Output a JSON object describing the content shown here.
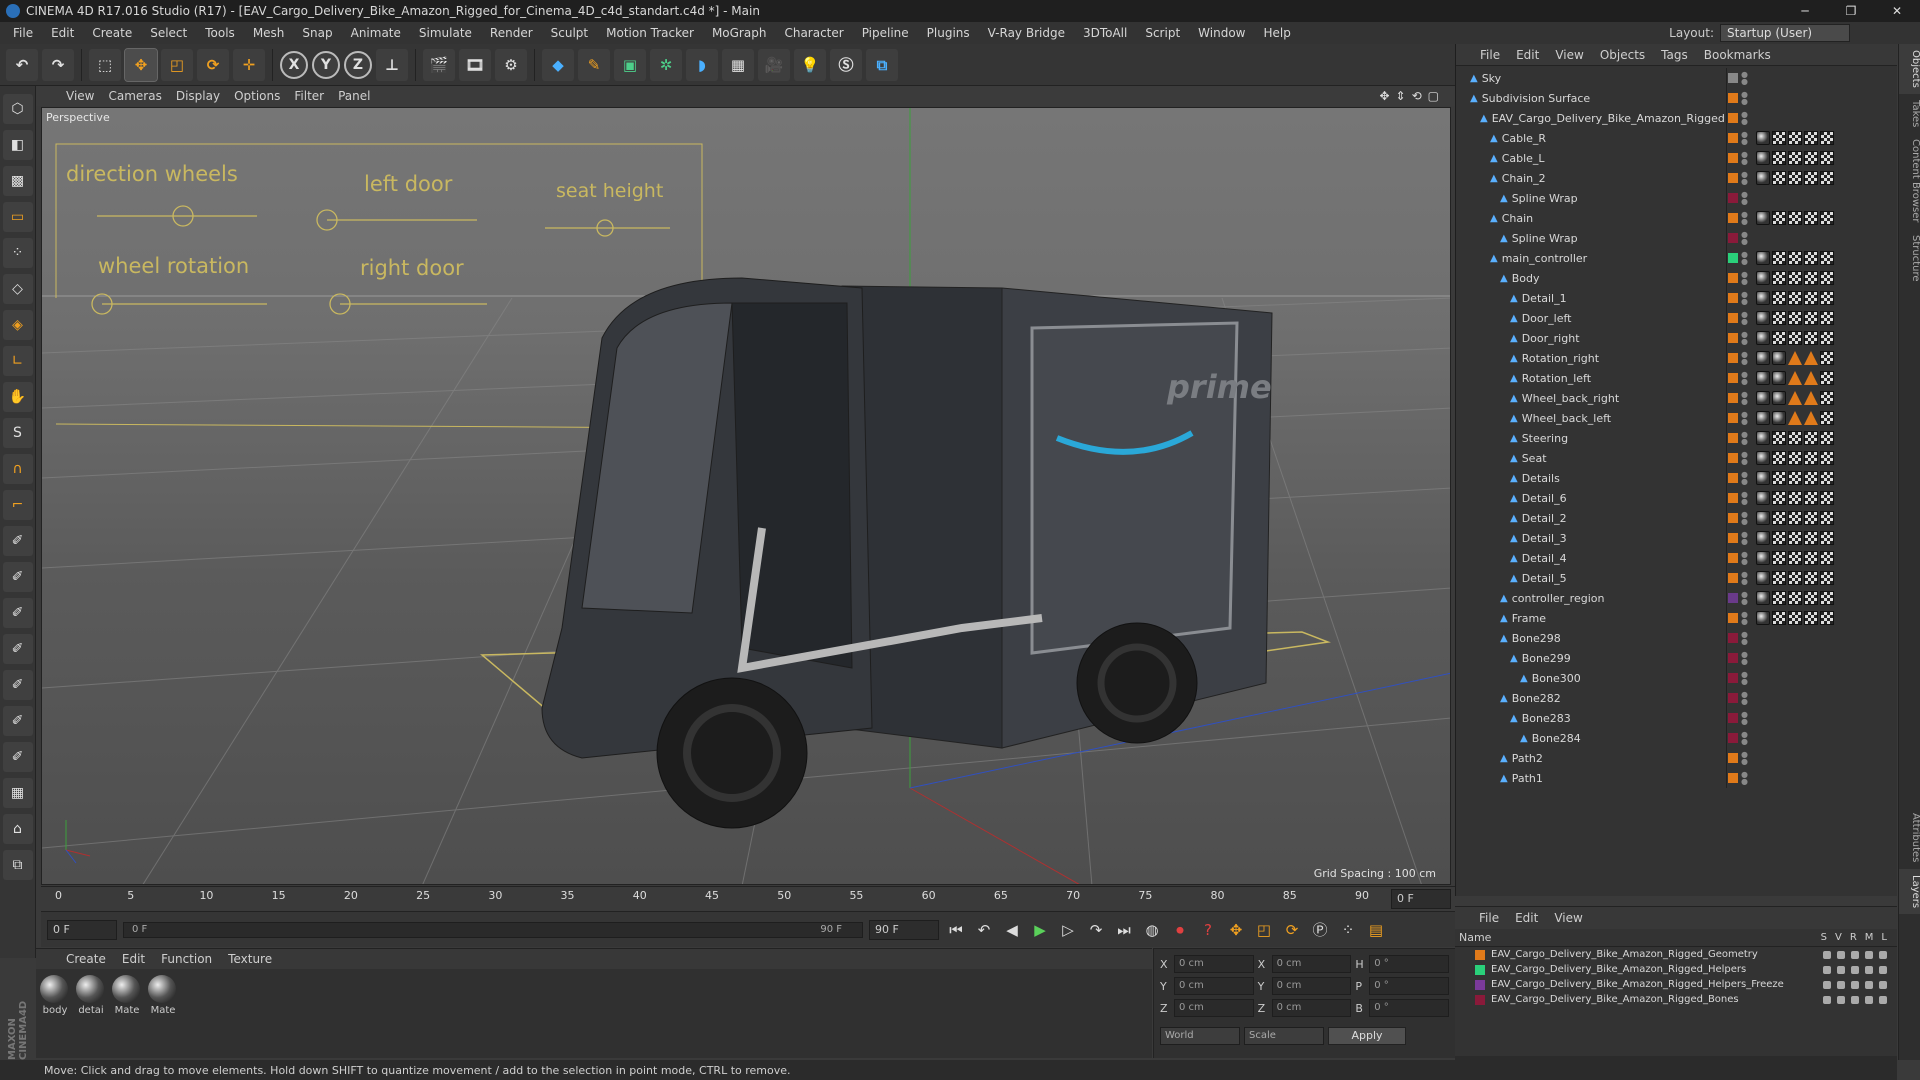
{
  "title": "CINEMA 4D R17.016 Studio (R17) - [EAV_Cargo_Delivery_Bike_Amazon_Rigged_for_Cinema_4D_c4d_standart.c4d *] - Main",
  "menu": [
    "File",
    "Edit",
    "Create",
    "Select",
    "Tools",
    "Mesh",
    "Snap",
    "Animate",
    "Simulate",
    "Render",
    "Sculpt",
    "Motion Tracker",
    "MoGraph",
    "Character",
    "Pipeline",
    "Plugins",
    "V-Ray Bridge",
    "3DToAll",
    "Script",
    "Window",
    "Help"
  ],
  "layout_label": "Layout:",
  "layout_value": "Startup (User)",
  "toolbar": {
    "x": "X",
    "y": "Y",
    "z": "Z"
  },
  "viewport": {
    "menu": [
      "View",
      "Cameras",
      "Display",
      "Options",
      "Filter",
      "Panel"
    ],
    "label": "Perspective",
    "grid": "Grid Spacing : 100 cm",
    "hud": {
      "direction_wheels": "direction wheels",
      "left_door": "left door",
      "seat_height": "seat height",
      "wheel_rotation": "wheel rotation",
      "right_door": "right door"
    },
    "hud_values": {
      "direction_wheels": 0.55,
      "left_door": 0.0,
      "seat_height": 0.4,
      "wheel_rotation": 0.0,
      "right_door": 0.0
    }
  },
  "timeline": {
    "ticks": [
      "0",
      "5",
      "10",
      "15",
      "20",
      "25",
      "30",
      "35",
      "40",
      "45",
      "50",
      "55",
      "60",
      "65",
      "70",
      "75",
      "80",
      "85",
      "90"
    ],
    "frame_field": "0 F"
  },
  "playback": {
    "start": "0 F",
    "current": "0 F",
    "end": "90 F",
    "end2": "90 F"
  },
  "material_panel": {
    "menu": [
      "Create",
      "Edit",
      "Function",
      "Texture"
    ],
    "materials": [
      "body",
      "detai",
      "Mate",
      "Mate"
    ]
  },
  "coords": {
    "x": "0 cm",
    "y": "0 cm",
    "z": "0 cm",
    "sx": "0 cm",
    "sy": "0 cm",
    "sz": "0 cm",
    "h": "0 °",
    "p": "0 °",
    "b": "0 °",
    "world": "World",
    "scale": "Scale",
    "apply": "Apply"
  },
  "status": "Move: Click and drag to move elements. Hold down SHIFT to quantize movement / add to the selection in point mode, CTRL to remove.",
  "object_manager": {
    "menu": [
      "File",
      "Edit",
      "View",
      "Objects",
      "Tags",
      "Bookmarks"
    ],
    "rows": [
      {
        "name": "Sky",
        "indent": 0,
        "color": "#888888"
      },
      {
        "name": "Subdivision Surface",
        "indent": 0,
        "color": "#e07a1a"
      },
      {
        "name": "EAV_Cargo_Delivery_Bike_Amazon_Rigged",
        "indent": 1,
        "color": "#e07a1a"
      },
      {
        "name": "Cable_R",
        "indent": 2,
        "color": "#e07a1a"
      },
      {
        "name": "Cable_L",
        "indent": 2,
        "color": "#e07a1a"
      },
      {
        "name": "Chain_2",
        "indent": 2,
        "color": "#e07a1a"
      },
      {
        "name": "Spline Wrap",
        "indent": 3,
        "color": "#8a1a3a"
      },
      {
        "name": "Chain",
        "indent": 2,
        "color": "#e07a1a"
      },
      {
        "name": "Spline Wrap",
        "indent": 3,
        "color": "#8a1a3a"
      },
      {
        "name": "main_controller",
        "indent": 2,
        "color": "#2ad07a"
      },
      {
        "name": "Body",
        "indent": 3,
        "color": "#e07a1a"
      },
      {
        "name": "Detail_1",
        "indent": 4,
        "color": "#e07a1a"
      },
      {
        "name": "Door_left",
        "indent": 4,
        "color": "#e07a1a"
      },
      {
        "name": "Door_right",
        "indent": 4,
        "color": "#e07a1a"
      },
      {
        "name": "Rotation_right",
        "indent": 4,
        "color": "#e07a1a"
      },
      {
        "name": "Rotation_left",
        "indent": 4,
        "color": "#e07a1a"
      },
      {
        "name": "Wheel_back_right",
        "indent": 4,
        "color": "#e07a1a"
      },
      {
        "name": "Wheel_back_left",
        "indent": 4,
        "color": "#e07a1a"
      },
      {
        "name": "Steering",
        "indent": 4,
        "color": "#e07a1a"
      },
      {
        "name": "Seat",
        "indent": 4,
        "color": "#e07a1a"
      },
      {
        "name": "Details",
        "indent": 4,
        "color": "#e07a1a"
      },
      {
        "name": "Detail_6",
        "indent": 4,
        "color": "#e07a1a"
      },
      {
        "name": "Detail_2",
        "indent": 4,
        "color": "#e07a1a"
      },
      {
        "name": "Detail_3",
        "indent": 4,
        "color": "#e07a1a"
      },
      {
        "name": "Detail_4",
        "indent": 4,
        "color": "#e07a1a"
      },
      {
        "name": "Detail_5",
        "indent": 4,
        "color": "#e07a1a"
      },
      {
        "name": "controller_region",
        "indent": 3,
        "color": "#6a3a8a"
      },
      {
        "name": "Frame",
        "indent": 3,
        "color": "#e07a1a"
      },
      {
        "name": "Bone298",
        "indent": 3,
        "color": "#8a1a3a"
      },
      {
        "name": "Bone299",
        "indent": 4,
        "color": "#8a1a3a"
      },
      {
        "name": "Bone300",
        "indent": 5,
        "color": "#8a1a3a"
      },
      {
        "name": "Bone282",
        "indent": 3,
        "color": "#8a1a3a"
      },
      {
        "name": "Bone283",
        "indent": 4,
        "color": "#8a1a3a"
      },
      {
        "name": "Bone284",
        "indent": 5,
        "color": "#8a1a3a"
      },
      {
        "name": "Path2",
        "indent": 3,
        "color": "#e07a1a"
      },
      {
        "name": "Path1",
        "indent": 3,
        "color": "#e07a1a"
      }
    ]
  },
  "layer_manager": {
    "menu": [
      "File",
      "Edit",
      "View"
    ],
    "head": "Name",
    "flags": [
      "S",
      "V",
      "R",
      "M",
      "L"
    ],
    "layers": [
      {
        "name": "EAV_Cargo_Delivery_Bike_Amazon_Rigged_Geometry",
        "color": "#e07a1a"
      },
      {
        "name": "EAV_Cargo_Delivery_Bike_Amazon_Rigged_Helpers",
        "color": "#2ad07a"
      },
      {
        "name": "EAV_Cargo_Delivery_Bike_Amazon_Rigged_Helpers_Freeze",
        "color": "#7a3a9a"
      },
      {
        "name": "EAV_Cargo_Delivery_Bike_Amazon_Rigged_Bones",
        "color": "#8a1a3a"
      }
    ]
  },
  "side_tabs": [
    "Objects",
    "Takes",
    "Content Browser",
    "Structure",
    "Attributes",
    "Layers"
  ]
}
